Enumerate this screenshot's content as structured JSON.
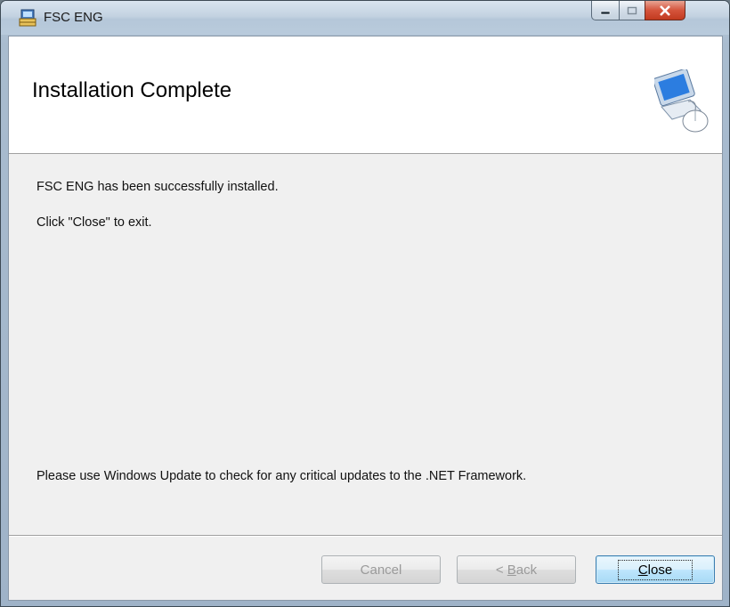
{
  "window": {
    "title": "FSC ENG",
    "icon": "installer-icon",
    "controls": [
      "minimize-icon",
      "maximize-icon",
      "close-icon"
    ]
  },
  "banner": {
    "title": "Installation Complete",
    "icon": "computer-setup-icon"
  },
  "messages": {
    "installed": "FSC ENG has been successfully installed.",
    "click_close": "Click \"Close\" to exit.",
    "windows_update": "Please use Windows Update to check for any critical updates to the .NET Framework."
  },
  "buttons": {
    "cancel": {
      "label": "Cancel",
      "enabled": false
    },
    "back": {
      "prefix": "< ",
      "accel": "B",
      "rest": "ack",
      "enabled": false
    },
    "close": {
      "accel": "C",
      "rest": "lose",
      "enabled": true,
      "default": true
    }
  }
}
